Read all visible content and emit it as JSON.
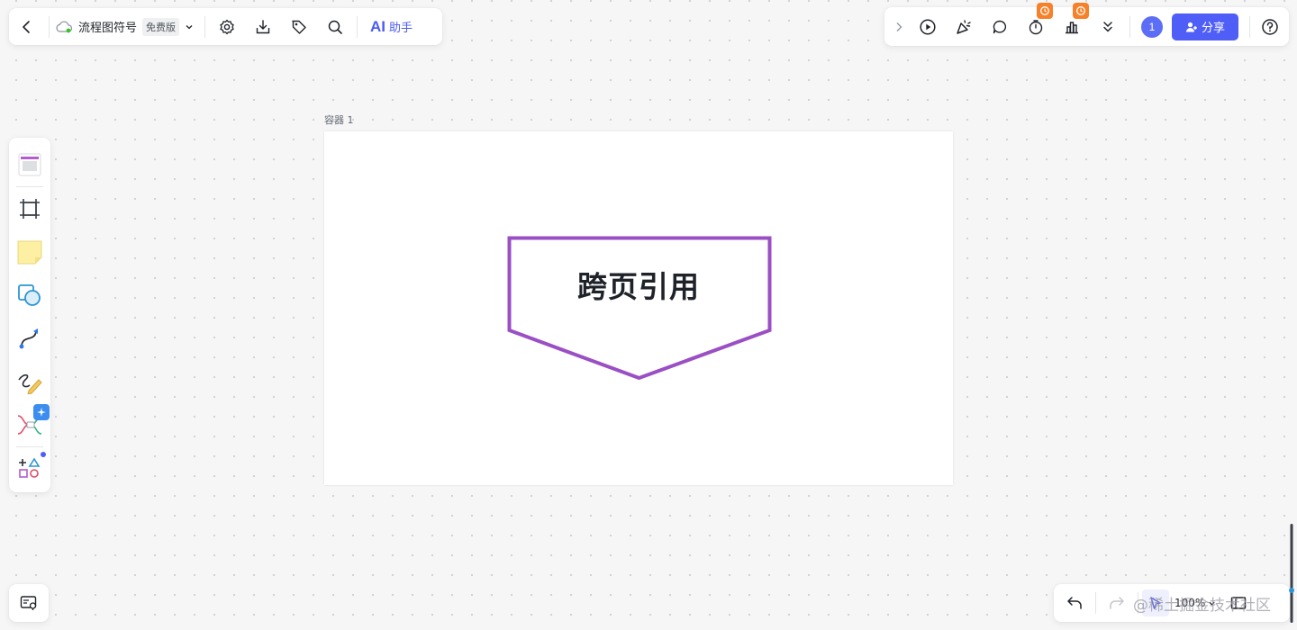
{
  "header": {
    "doc_title": "流程图符号",
    "plan_badge": "免费版",
    "ai_logo": "AI",
    "ai_label": "助手",
    "icons": [
      "back-icon",
      "cloud-icon",
      "settings-icon",
      "download-icon",
      "tag-icon",
      "search-icon"
    ]
  },
  "top_right": {
    "avatar_count": "1",
    "share_label": "分享",
    "icons": [
      "collapse-icon",
      "play-icon",
      "celebrate-icon",
      "comment-icon",
      "timer-icon",
      "vote-icon",
      "more-icon",
      "help-icon"
    ]
  },
  "left_toolbar": {
    "tools": [
      "template",
      "frame",
      "sticky-note",
      "shape",
      "connector",
      "pen",
      "mindmap",
      "more-tools"
    ]
  },
  "canvas": {
    "container_label": "容器 1",
    "shape_text": "跨页引用",
    "shape_color": "#9b4fc4"
  },
  "bottom_right": {
    "zoom_label": "100%",
    "watermark": "@稀土掘金技术社区"
  },
  "colors": {
    "accent": "#4f5ef7",
    "notification": "#f5822a"
  }
}
